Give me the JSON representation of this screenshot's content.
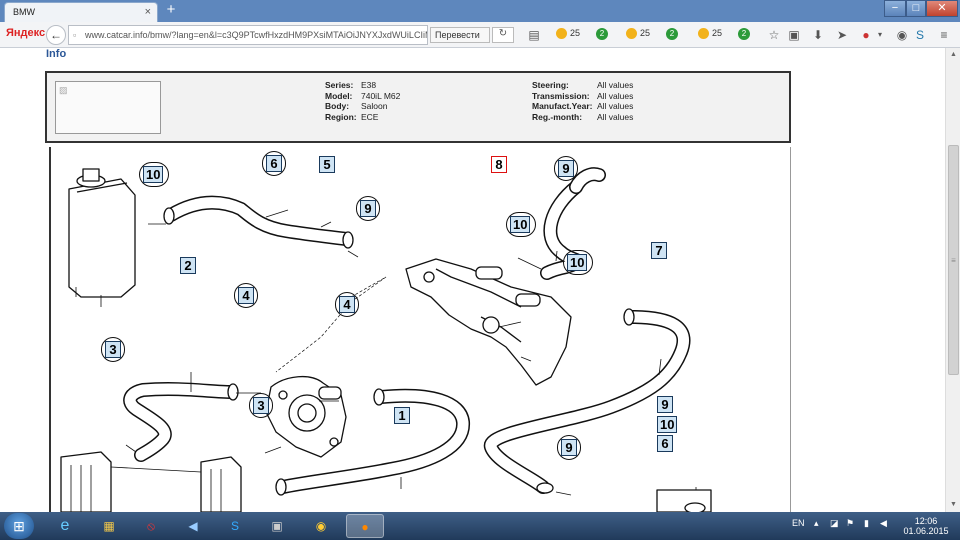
{
  "browser": {
    "tab_title": "BMW",
    "tab_close": "×",
    "new_tab": "+",
    "window_controls": [
      "−",
      "□",
      "✕"
    ],
    "search_brand": "Яндекс",
    "url": "www.catcar.info/bmw/?lang=en&l=c3Q9PTcwfHxzdHM9PXsiMTAiOiJNYXJxdWUiLCIiMCI",
    "translate_label": "Перевести",
    "extensions": [
      {
        "icon": "sun-icon",
        "value": "25"
      },
      {
        "icon": "badge-2-icon",
        "value": "2"
      },
      {
        "icon": "sun-icon",
        "value": "25"
      },
      {
        "icon": "badge-2-icon",
        "value": "2"
      },
      {
        "icon": "sun-icon",
        "value": "25"
      },
      {
        "icon": "badge-2-icon",
        "value": "2"
      }
    ]
  },
  "page": {
    "section_title": "Info",
    "info": {
      "series_label": "Series:",
      "series_value": "E38",
      "model_label": "Model:",
      "model_value": "740iL M62",
      "body_label": "Body:",
      "body_value": "Saloon",
      "region_label": "Region:",
      "region_value": "ECE",
      "steering_label": "Steering:",
      "steering_value": "All values",
      "transmission_label": "Transmission:",
      "transmission_value": "All values",
      "year_label": "Manufact.Year:",
      "year_value": "All values",
      "month_label": "Reg.-month:",
      "month_value": "All values"
    },
    "callouts": {
      "c10a": "10",
      "c6a": "6",
      "c5": "5",
      "c9a": "9",
      "c8": "8",
      "c9b": "9",
      "c10b": "10",
      "c10c": "10",
      "c2": "2",
      "c4a": "4",
      "c4b": "4",
      "c7": "7",
      "c3a": "3",
      "c3b": "3",
      "c1": "1",
      "c9c": "9",
      "legend9": "9",
      "legend10": "10",
      "legend6": "6"
    }
  },
  "taskbar": {
    "language": "EN",
    "time": "12:06",
    "date": "01.06.2015"
  }
}
